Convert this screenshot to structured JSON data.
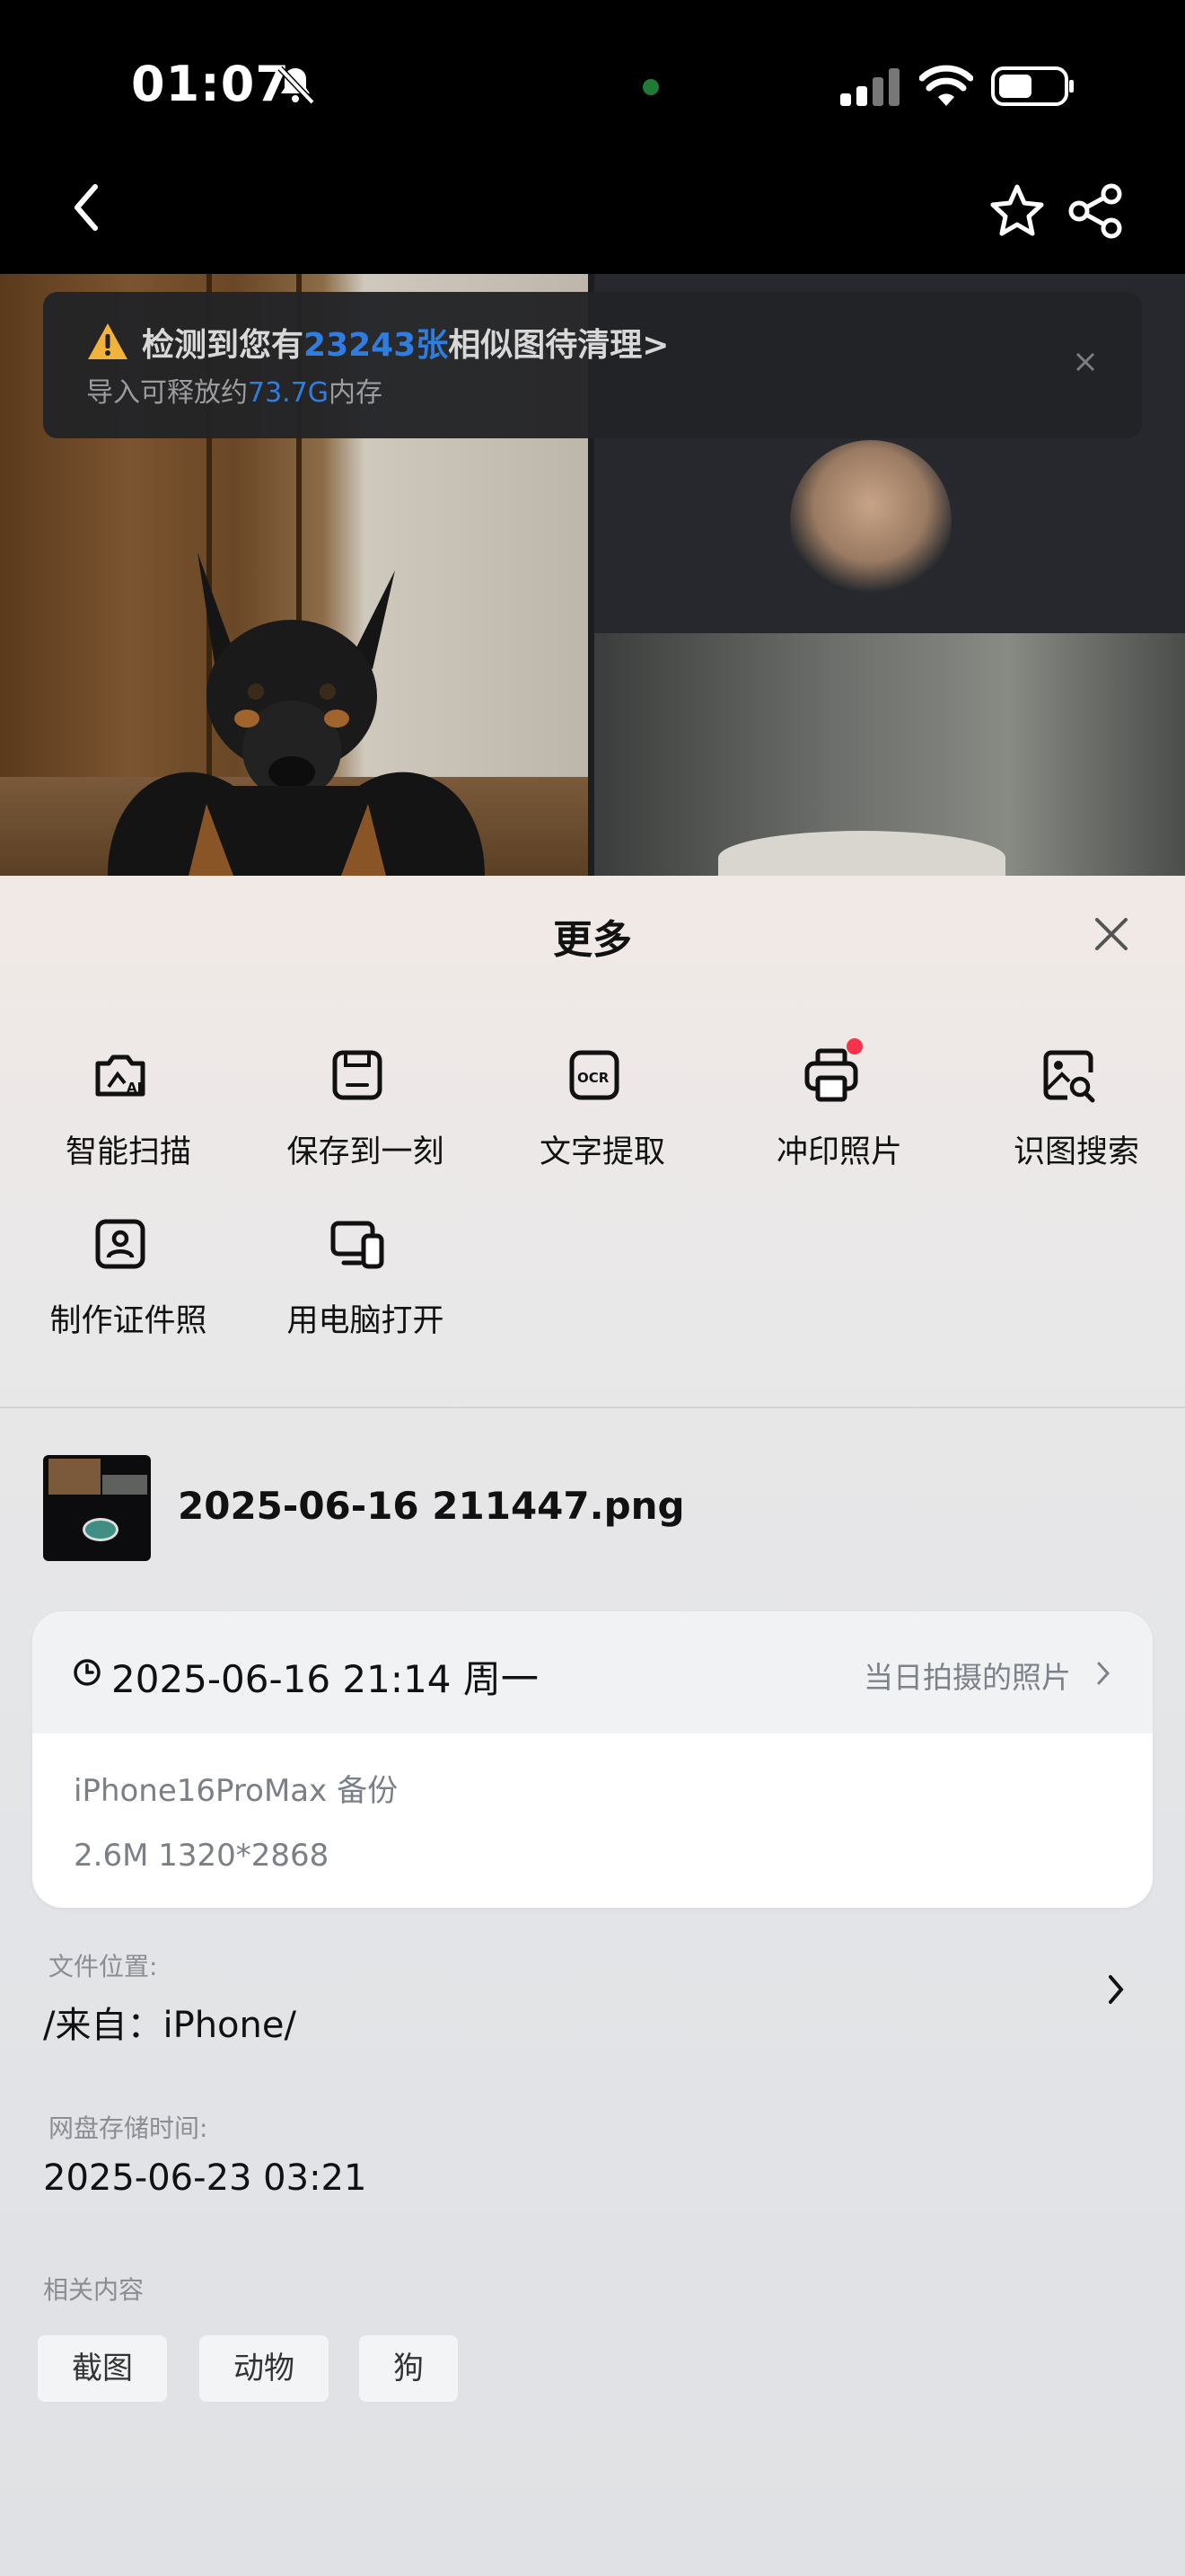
{
  "status_bar": {
    "time": "01:07",
    "icons": [
      "bell-slash-icon",
      "cellular-signal-icon",
      "wifi-icon",
      "battery-icon"
    ]
  },
  "nav": {
    "icons": [
      "chevron-left-icon",
      "star-icon",
      "share-icon"
    ]
  },
  "notice": {
    "title_prefix": "检测到您有",
    "count": "23243张",
    "title_suffix": "相似图待清理>",
    "sub_prefix": "导入可释放约",
    "size": "73.7G",
    "sub_suffix": "内存",
    "accent": "#2f7de1"
  },
  "sheet": {
    "title": "更多",
    "actions": [
      {
        "label": "智能扫描",
        "icon": "smart-scan-icon"
      },
      {
        "label": "保存到一刻",
        "icon": "save-icon"
      },
      {
        "label": "文字提取",
        "icon": "ocr-icon"
      },
      {
        "label": "冲印照片",
        "icon": "printer-icon"
      },
      {
        "label": "识图搜索",
        "icon": "image-search-icon"
      },
      {
        "label": "制作证件照",
        "icon": "id-photo-icon"
      },
      {
        "label": "用电脑打开",
        "icon": "open-on-computer-icon"
      }
    ]
  },
  "file": {
    "name": "2025-06-16 211447.png"
  },
  "card": {
    "datetime": "2025-06-16 21:14 周一",
    "link": "当日拍摄的照片",
    "device": "iPhone16ProMax 备份",
    "meta": "2.6M 1320*2868"
  },
  "location": {
    "label": "文件位置:",
    "value": "/来自：iPhone/"
  },
  "storage": {
    "label": "网盘存储时间:",
    "value": "2025-06-23 03:21"
  },
  "related": {
    "label": "相关内容",
    "tags": [
      "截图",
      "动物",
      "狗"
    ]
  }
}
